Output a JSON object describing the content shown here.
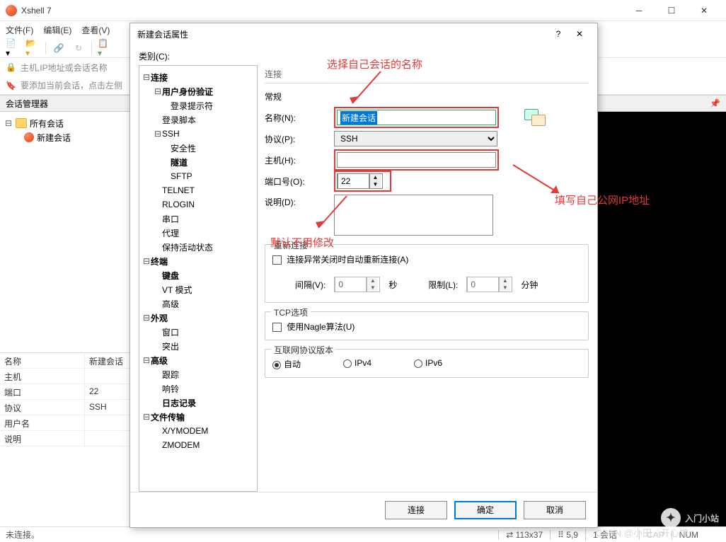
{
  "app": {
    "title": "Xshell 7"
  },
  "menu": {
    "file": "文件(F)",
    "edit": "编辑(E)",
    "view": "查看(V)"
  },
  "addr": {
    "placeholder": "主机,IP地址或会话名称",
    "tip": "要添加当前会话，点击左侧"
  },
  "sessionmgr": {
    "title": "会话管理器"
  },
  "tree": {
    "all": "所有会话",
    "new": "新建会话"
  },
  "props": {
    "name_k": "名称",
    "name_v": "新建会话",
    "host_k": "主机",
    "host_v": "",
    "port_k": "端口",
    "port_v": "22",
    "proto_k": "协议",
    "proto_v": "SSH",
    "user_k": "用户名",
    "user_v": "",
    "desc_k": "说明",
    "desc_v": ""
  },
  "dialog": {
    "title": "新建会话属性",
    "category": "类别(C):",
    "section": "连接",
    "general": "常规",
    "name_l": "名称(N):",
    "name_v": "新建会话",
    "proto_l": "协议(P):",
    "proto_v": "SSH",
    "host_l": "主机(H):",
    "host_v": "",
    "port_l": "端口号(O):",
    "port_v": "22",
    "desc_l": "说明(D):",
    "desc_v": "",
    "reconnect_g": "重新连接",
    "reconnect_cb": "连接异常关闭时自动重新连接(A)",
    "interval_l": "间隔(V):",
    "interval_v": "0",
    "sec": "秒",
    "limit_l": "限制(L):",
    "limit_v": "0",
    "min": "分钟",
    "tcp_g": "TCP选项",
    "nagle_cb": "使用Nagle算法(U)",
    "ipver_g": "互联网协议版本",
    "auto": "自动",
    "ipv4": "IPv4",
    "ipv6": "IPv6",
    "connect": "连接",
    "ok": "确定",
    "cancel": "取消"
  },
  "cat": {
    "conn": "连接",
    "auth": "用户身份验证",
    "prompt": "登录提示符",
    "script": "登录脚本",
    "ssh": "SSH",
    "sec": "安全性",
    "tunnel": "隧道",
    "sftp": "SFTP",
    "telnet": "TELNET",
    "rlogin": "RLOGIN",
    "serial": "串口",
    "proxy": "代理",
    "keep": "保持活动状态",
    "term": "终端",
    "kbd": "键盘",
    "vt": "VT 模式",
    "adv": "高级",
    "appear": "外观",
    "win": "窗口",
    "highlight": "突出",
    "adv2": "高级",
    "trace": "跟踪",
    "bell": "响铃",
    "log": "日志记录",
    "ft": "文件传输",
    "xy": "X/YMODEM",
    "zm": "ZMODEM"
  },
  "annot": {
    "a1": "选择自己会话的名称",
    "a2": "填写自己公网IP地址",
    "a3": "默认不用修改"
  },
  "status": {
    "disconnected": "未连接。",
    "size": "113x37",
    "pos": "5,9",
    "sess": "1 会话",
    "caps": "CAP",
    "num": "NUM"
  },
  "wm": {
    "t1": "入门小站",
    "t2": "CSDN @小田『开心馆』"
  }
}
